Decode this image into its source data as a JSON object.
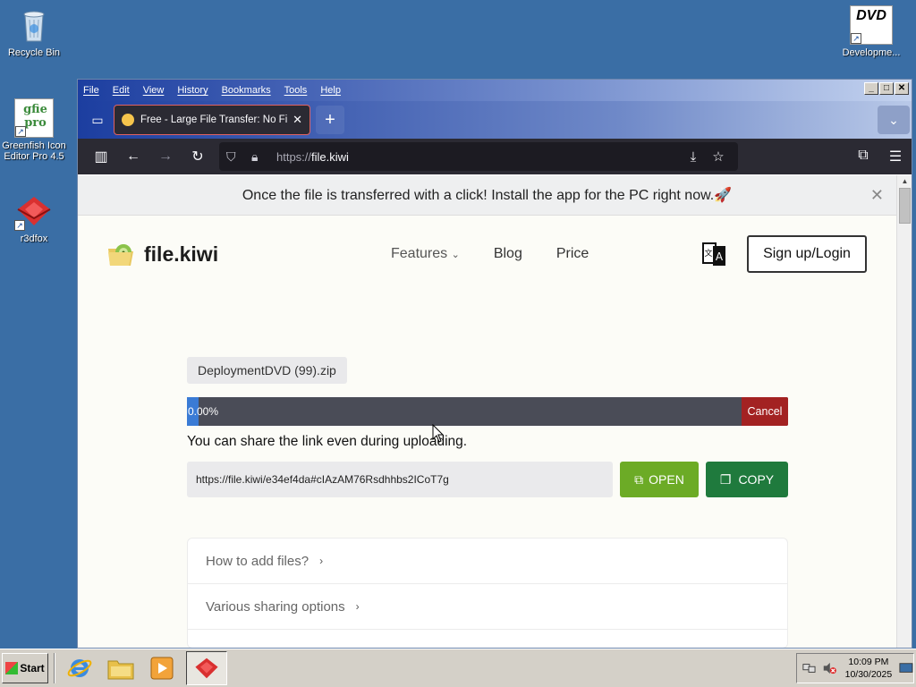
{
  "desktop": {
    "icons": [
      {
        "label": "Recycle Bin"
      },
      {
        "label": "Greenfish Icon Editor Pro 4.5"
      },
      {
        "label": "r3dfox"
      },
      {
        "label": "Developme..."
      }
    ],
    "gfie_text": "gfie pro",
    "dvd_text": "DVD"
  },
  "browser": {
    "menu": [
      "File",
      "Edit",
      "View",
      "History",
      "Bookmarks",
      "Tools",
      "Help"
    ],
    "tab_title": "Free - Large File Transfer: No File S",
    "url_scheme": "https://",
    "url_host": "file.kiwi"
  },
  "page": {
    "banner": "Once the file is transferred with a click! Install the app for the PC right now.🚀",
    "logo_text": "file.kiwi",
    "nav": {
      "features": "Features",
      "blog": "Blog",
      "price": "Price"
    },
    "signup": "Sign up/Login",
    "filename": "DeploymentDVD (99).zip",
    "progress_text": "0.00%",
    "progress_value": 0,
    "cancel": "Cancel",
    "share_note": "You can share the link even during uploading.",
    "link": "https://file.kiwi/e34ef4da#cIAzAM76Rsdhhbs2ICoT7g",
    "open": "OPEN",
    "copy": "COPY",
    "faq": [
      "How to add files?",
      "Various sharing options"
    ]
  },
  "taskbar": {
    "start": "Start",
    "time": "10:09 PM",
    "date": "10/30/2025"
  }
}
